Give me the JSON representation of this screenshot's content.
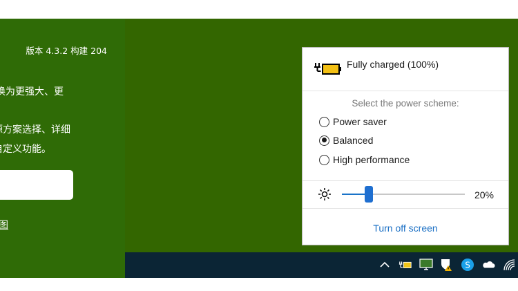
{
  "app_panel": {
    "version_text": "版本 4.3.2 构建 204",
    "line1": "器替换为更强大、更",
    "line2": "电源方案选择、详细",
    "line3": "的自定义功能。",
    "link_text": "图"
  },
  "flyout": {
    "battery_status": "Fully charged (100%)",
    "scheme_label": "Select the power scheme:",
    "schemes": [
      {
        "label": "Power saver",
        "selected": false
      },
      {
        "label": "Balanced",
        "selected": true
      },
      {
        "label": "High performance",
        "selected": false
      }
    ],
    "brightness_value": "20%",
    "brightness_level": 0.2,
    "turn_off_label": "Turn off screen"
  },
  "colors": {
    "left_panel": "#2f6b06",
    "desktop": "#336600",
    "taskbar": "#0b2535",
    "accent": "#1f6fd0"
  },
  "tray_icons": [
    "chevron-up-icon",
    "battery-icon",
    "network-monitor-icon",
    "security-warning-icon",
    "skype-icon",
    "onedrive-icon",
    "wifi-icon"
  ]
}
